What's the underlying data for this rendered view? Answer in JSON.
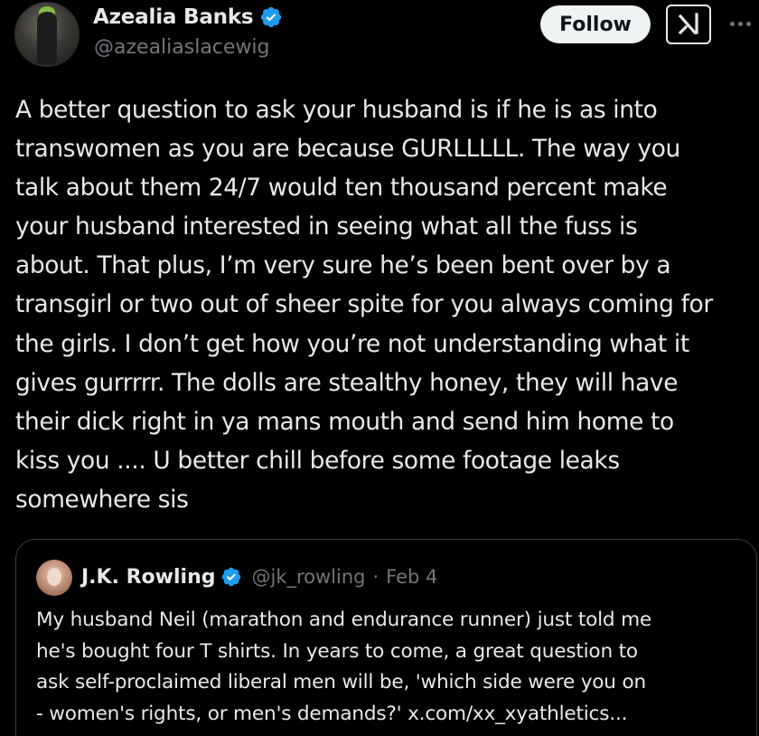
{
  "author": {
    "name": "Azealia Banks",
    "handle": "@azealiaslacewig",
    "verified": true
  },
  "actions": {
    "follow_label": "Follow",
    "grok_icon": "grok-icon",
    "more_icon": "more-icon"
  },
  "tweet": {
    "text": "A better question to ask your husband is if he is as into\ntranswomen as you are because GURLLLLL. The way you\ntalk about them 24/7 would ten thousand percent make\nyour husband interested in seeing what all the fuss is\nabout. That plus, I’m very sure he’s been bent over by a\ntransgirl or two out of sheer spite for you always coming for\nthe girls. I don’t get how you’re not understanding what it\ngives gurrrrr. The dolls are stealthy honey, they will have\ntheir dick right in ya mans mouth and send him home to\nkiss you .... U better chill before some footage leaks\nsomewhere sis"
  },
  "quoted": {
    "name": "J.K. Rowling",
    "handle": "@jk_rowling",
    "separator": "·",
    "date": "Feb 4",
    "verified": true,
    "text": "My husband Neil (marathon and endurance runner) just told me\nhe's bought four T shirts. In years to come, a great question to\nask self-proclaimed liberal men will be, 'which side were you on\n- women's rights, or men's demands?' x.com/xx_xyathletics..."
  },
  "colors": {
    "background": "#000000",
    "text": "#e7e9ea",
    "secondary": "#71767b",
    "verified_blue": "#1d9bf0",
    "border": "#3a3f44"
  }
}
